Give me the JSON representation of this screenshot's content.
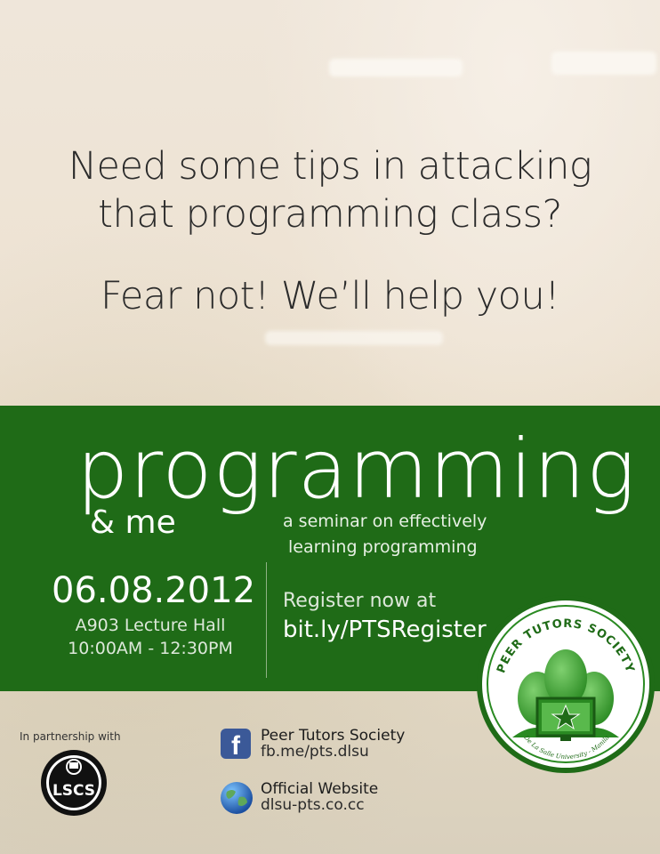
{
  "headline": {
    "line1": "Need some tips in attacking",
    "line2": "that programming class?",
    "line3": "Fear not! We’ll help you!"
  },
  "event": {
    "title": "programming",
    "subtitle": "& me",
    "tagline_line1": "a seminar on effectively",
    "tagline_line2": "learning programming",
    "date": "06.08.2012",
    "venue": "A903 Lecture Hall",
    "time": "10:00AM - 12:30PM",
    "register_label": "Register now at",
    "register_link": "bit.ly/PTSRegister"
  },
  "logo": {
    "arc_text": "PEER TUTORS SOCIETY",
    "bottom_text": "De La Salle University - Manila",
    "colors": {
      "ring": "#ffffff",
      "green": "#1f6b17",
      "bright": "#3d9b33"
    }
  },
  "footer": {
    "partnership_label": "In partnership with",
    "partner_logo_text": "LSCS",
    "facebook": {
      "title": "Peer Tutors Society",
      "url": "fb.me/pts.dlsu",
      "icon": "facebook-icon"
    },
    "website": {
      "title": "Official Website",
      "url": "dlsu-pts.co.cc",
      "icon": "globe-icon"
    }
  },
  "colors": {
    "band": "#1f6b17",
    "headline_text": "#2b2b2b"
  }
}
